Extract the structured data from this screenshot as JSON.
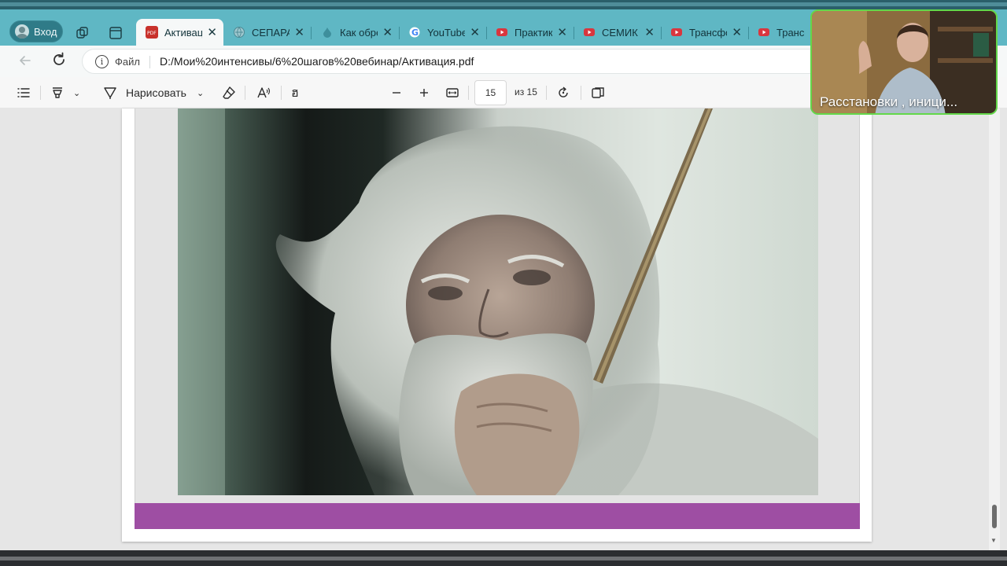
{
  "browser": {
    "profile_label": "Вход",
    "tabs": [
      {
        "title": "Активаци",
        "favicon": "pdf-icon",
        "active": true
      },
      {
        "title": "СЕПАРАЦ",
        "favicon": "globe-icon",
        "active": false
      },
      {
        "title": "Как обре",
        "favicon": "drop-icon",
        "active": false
      },
      {
        "title": "YouTube",
        "favicon": "google-icon",
        "active": false
      },
      {
        "title": "Практика",
        "favicon": "youtube-icon",
        "active": false
      },
      {
        "title": "СЕМИК п",
        "favicon": "youtube-icon",
        "active": false
      },
      {
        "title": "Трансфор",
        "favicon": "youtube-icon",
        "active": false
      },
      {
        "title": "Трансфо",
        "favicon": "youtube-icon",
        "active": false
      }
    ],
    "address": {
      "info_label": "Файл",
      "url": "D:/Мои%20интенсивы/6%20шагов%20вебинар/Активация.pdf"
    }
  },
  "pdf_toolbar": {
    "draw_label": "Нарисовать",
    "current_page": "15",
    "page_of": "из 15",
    "read_aloud_glyph": "A⁾",
    "translate_glyph": "ฮ"
  },
  "document": {
    "photo_description_icon": "elderly-man-photo",
    "accent_color": "#9e4ea3"
  },
  "webcam": {
    "caption": "Расстановки , иници..."
  },
  "colors": {
    "tabbar": "#5fb7c4",
    "active_tab": "#f6f8f8",
    "webcam_border": "#63d84a",
    "purple_bar": "#9e4ea3"
  }
}
